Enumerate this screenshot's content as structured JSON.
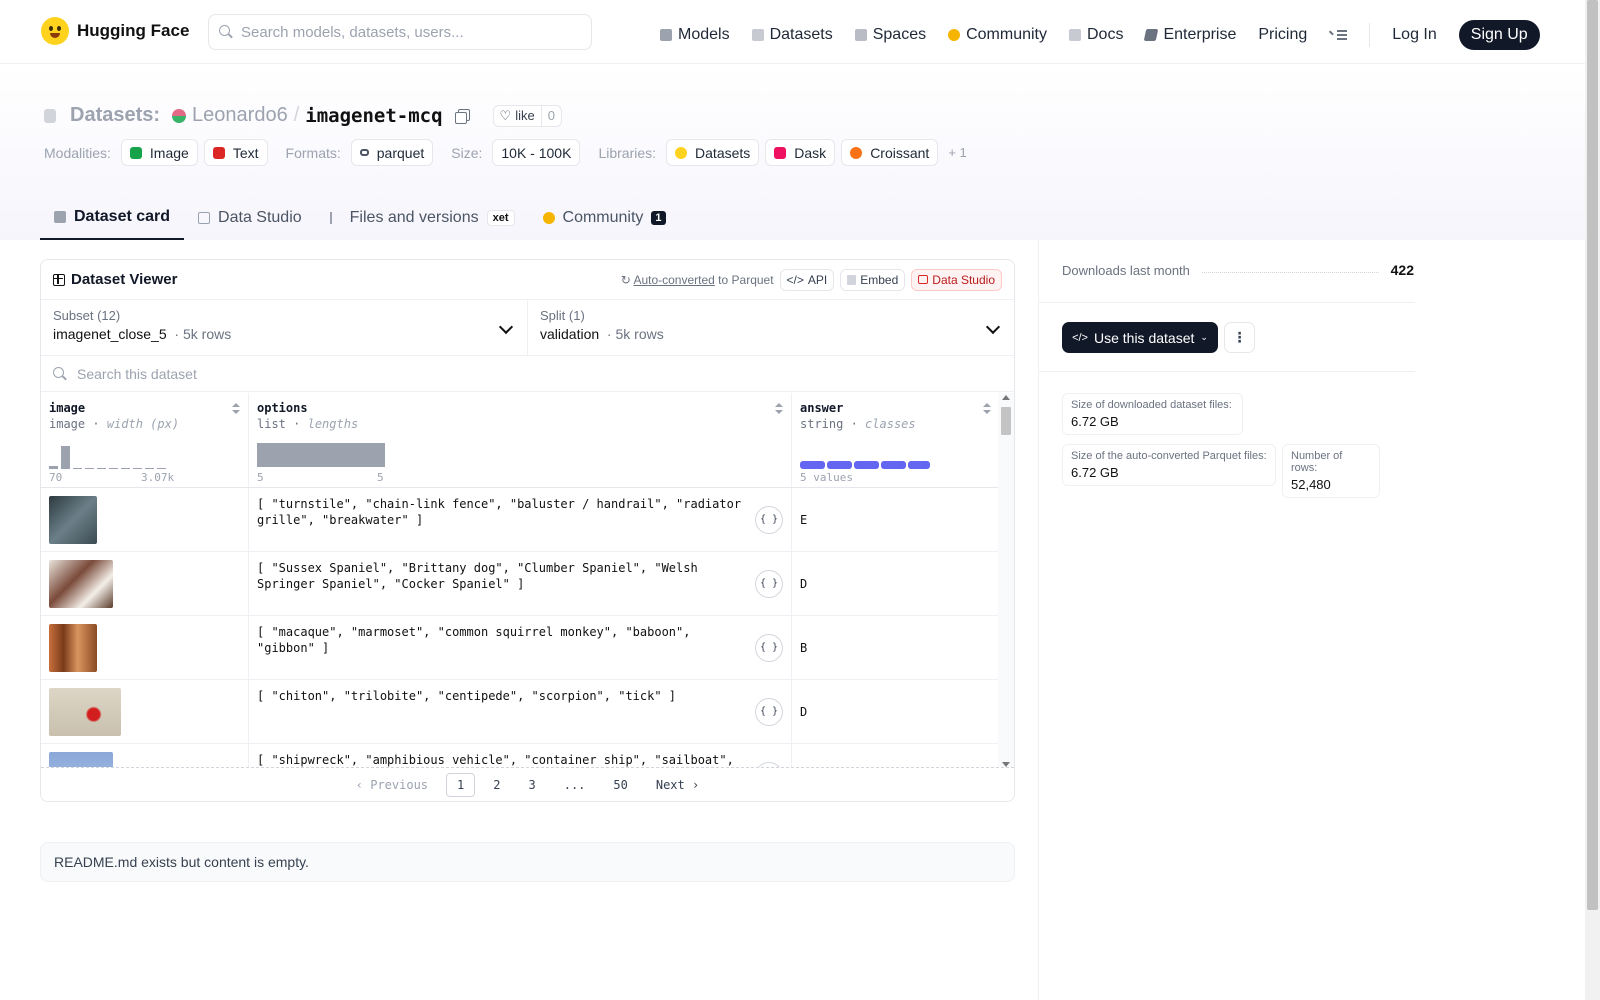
{
  "nav": {
    "brand": "Hugging Face",
    "search_placeholder": "Search models, datasets, users...",
    "links": [
      {
        "label": "Models",
        "icon": "models-icon",
        "color": "#9ca3af"
      },
      {
        "label": "Datasets",
        "icon": "datasets-icon",
        "color": "#c7cad1"
      },
      {
        "label": "Spaces",
        "icon": "spaces-icon",
        "color": "#b9bcc4"
      },
      {
        "label": "Community",
        "icon": "community-icon",
        "color": "#f5b400"
      },
      {
        "label": "Docs",
        "icon": "docs-icon",
        "color": "#c7cad1"
      },
      {
        "label": "Enterprise",
        "icon": "enterprise-icon",
        "color": "#6b7280"
      },
      {
        "label": "Pricing",
        "icon": "",
        "color": ""
      }
    ],
    "login": "Log In",
    "signup": "Sign Up"
  },
  "header": {
    "prefix": "Datasets:",
    "owner": "Leonardo6",
    "slash": "/",
    "repo": "imagenet-mcq",
    "like_label": "like",
    "like_count": "0",
    "modalities_label": "Modalities:",
    "modalities": [
      {
        "label": "Image",
        "color": "#16a34a"
      },
      {
        "label": "Text",
        "color": "#dc2626"
      }
    ],
    "formats_label": "Formats:",
    "formats": [
      {
        "label": "parquet",
        "color": "#4b5563"
      }
    ],
    "size_label": "Size:",
    "size": "10K - 100K",
    "libraries_label": "Libraries:",
    "libraries": [
      {
        "label": "Datasets",
        "color": "#ffd21e"
      },
      {
        "label": "Dask",
        "color": "#ef1161"
      },
      {
        "label": "Croissant",
        "color": "#f97316"
      }
    ],
    "more": "+ 1"
  },
  "tabs": [
    {
      "label": "Dataset card",
      "active": true
    },
    {
      "label": "Data Studio"
    },
    {
      "label": "Files and versions",
      "badge": "xet"
    },
    {
      "label": "Community",
      "badge": "1"
    }
  ],
  "viewer": {
    "title": "Dataset Viewer",
    "auto_converted": "Auto-converted",
    "to_parquet": "to Parquet",
    "api": "API",
    "embed": "Embed",
    "data_studio": "Data Studio",
    "subset_label": "Subset (12)",
    "subset_value": "imagenet_close_5",
    "subset_rows": "5k rows",
    "split_label": "Split (1)",
    "split_value": "validation",
    "split_rows": "5k rows",
    "search_placeholder": "Search this dataset",
    "columns": [
      {
        "name": "image",
        "type": "image",
        "stat": "width (px)",
        "min": "70",
        "max": "3.07k"
      },
      {
        "name": "options",
        "type": "list",
        "stat": "lengths",
        "min": "5",
        "max": "5"
      },
      {
        "name": "answer",
        "type": "string",
        "stat": "classes",
        "summary": "5 values"
      }
    ],
    "image_hist": [
      0.1,
      0.9,
      0.05,
      0.05,
      0.05,
      0.05,
      0.05,
      0.05,
      0.05,
      0.05
    ],
    "rows": [
      {
        "options": "[ \"turnstile\", \"chain-link fence\", \"baluster / handrail\", \"radiator grille\", \"breakwater\" ]",
        "answer": "E",
        "thumb": "#4b5c66"
      },
      {
        "options": "[ \"Sussex Spaniel\", \"Brittany dog\", \"Clumber Spaniel\", \"Welsh Springer Spaniel\", \"Cocker Spaniel\" ]",
        "answer": "D",
        "thumb": "#7a4a3a"
      },
      {
        "options": "[ \"macaque\", \"marmoset\", \"common squirrel monkey\", \"baboon\", \"gibbon\" ]",
        "answer": "B",
        "thumb": "#a85a36"
      },
      {
        "options": "[ \"chiton\", \"trilobite\", \"centipede\", \"scorpion\", \"tick\" ]",
        "answer": "D",
        "thumb": "#d8d0c0"
      },
      {
        "options": "[ \"shipwreck\", \"amphibious vehicle\", \"container ship\", \"sailboat\",",
        "answer": "",
        "thumb": "#8aa8d8"
      }
    ],
    "pager": {
      "prev": "Previous",
      "pages": [
        "1",
        "2",
        "3",
        "...",
        "50"
      ],
      "next": "Next",
      "current": "1"
    }
  },
  "readme": "README.md exists but content is empty.",
  "sidebar": {
    "downloads_label": "Downloads last month",
    "downloads": "422",
    "use_button": "Use this dataset",
    "stats": [
      {
        "label": "Size of downloaded dataset files:",
        "value": "6.72 GB"
      },
      {
        "label": "Size of the auto-converted Parquet files:",
        "value": "6.72 GB"
      },
      {
        "label": "Number of rows:",
        "value": "52,480"
      }
    ]
  }
}
